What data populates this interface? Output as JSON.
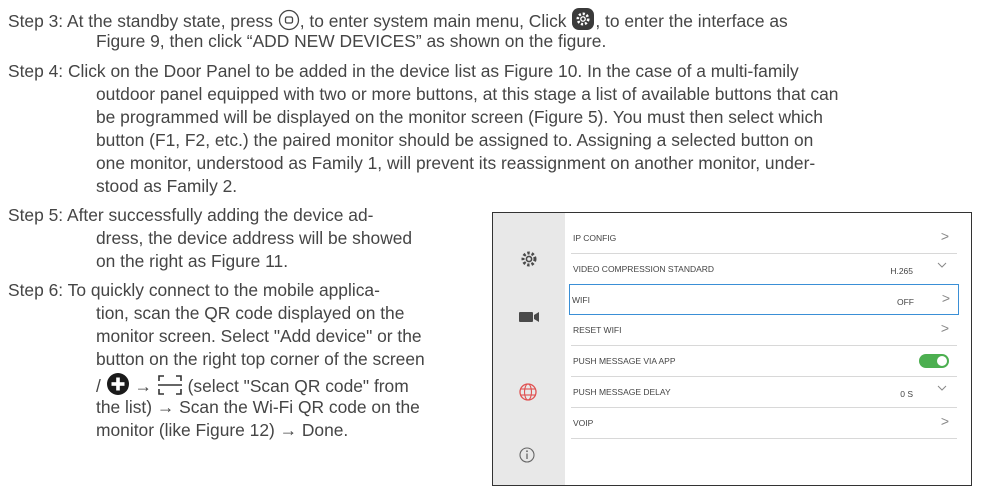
{
  "steps": {
    "step3": {
      "a": "Step 3: At the standby state, press",
      "b": ", to enter system main menu, Click",
      "c": ", to enter the interface as",
      "d": "Figure 9, then click “ADD NEW DEVICES” as shown on the figure."
    },
    "step4": [
      "Step 4: Click on the Door Panel to be added in the device list as Figure 10. In the case of a multi-family",
      "outdoor panel equipped with two or more buttons, at this stage a list of available buttons that can",
      "be programmed will be displayed on the monitor screen (Figure 5). You must then select which",
      "button (F1, F2, etc.) the paired monitor should be assigned to. Assigning a selected button on",
      "one monitor, understood as Family 1, will prevent its reassignment on another monitor, under-",
      "stood as Family 2."
    ],
    "step5": [
      "Step 5: After successfully adding the device ad-",
      "dress, the device address will be showed",
      "on the right as Figure 11."
    ],
    "step6": {
      "l1": "Step 6: To quickly connect to the mobile applica-",
      "l2": "tion, scan the QR code displayed on the",
      "l3": "monitor screen. Select \"Add device\" or the",
      "l4": "button on the right top corner of the screen",
      "l5a": "/",
      "l5b": "→",
      "l5c": "(select \"Scan QR code\" from",
      "l6": "the list) → Scan the Wi-Fi QR code on the",
      "l7": "monitor (like Figure 12) → Done."
    }
  },
  "monitor": {
    "accent": "#3a8fd6",
    "rows": [
      {
        "label": "IP CONFIG",
        "value": ""
      },
      {
        "label": "VIDEO COMPRESSION STANDARD",
        "value": "H.265"
      },
      {
        "label": "WIFI",
        "value": "OFF"
      },
      {
        "label": "RESET WIFI",
        "value": ""
      },
      {
        "label": "PUSH MESSAGE VIA APP",
        "value": ""
      },
      {
        "label": "PUSH MESSAGE DELAY",
        "value": "0 S"
      },
      {
        "label": "VOIP",
        "value": ""
      }
    ],
    "toggle_on": true,
    "sidebar_icons": [
      "gear-icon",
      "camera-icon",
      "globe-icon",
      "info-icon"
    ]
  }
}
